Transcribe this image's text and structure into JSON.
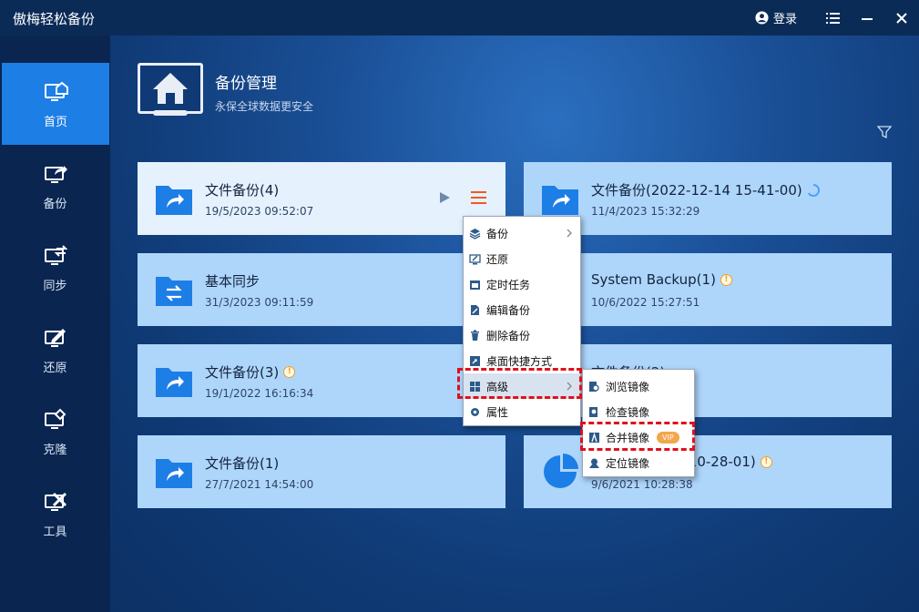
{
  "app": {
    "title": "傲梅轻松备份",
    "login_label": "登录"
  },
  "sidebar": {
    "items": [
      {
        "label": "首页",
        "icon": "home-monitor-icon",
        "active": true
      },
      {
        "label": "备份",
        "icon": "backup-icon"
      },
      {
        "label": "同步",
        "icon": "sync-icon"
      },
      {
        "label": "还原",
        "icon": "restore-icon"
      },
      {
        "label": "克隆",
        "icon": "clone-icon"
      },
      {
        "label": "工具",
        "icon": "tools-icon"
      }
    ]
  },
  "header": {
    "title": "备份管理",
    "subtitle": "永保全球数据更安全"
  },
  "cards": [
    {
      "name": "文件备份(4)",
      "date": "19/5/2023 09:52:07"
    },
    {
      "name": "文件备份(2022-12-14 15-41-00)",
      "date": "11/4/2023 15:32:29"
    },
    {
      "name": "基本同步",
      "date": "31/3/2023 09:11:59"
    },
    {
      "name": "System Backup(1)",
      "date": "10/6/2022 15:27:51"
    },
    {
      "name": "文件备份(3)",
      "date": "19/1/2022 16:16:34"
    },
    {
      "name": "文件备份(2)",
      "date": ""
    },
    {
      "name": "文件备份(1)",
      "date": "27/7/2021 14:54:00"
    },
    {
      "name": "5-09 10-28-01)",
      "date": "9/6/2021 10:28:38"
    }
  ],
  "context_menu": {
    "items": [
      "备份",
      "还原",
      "定时任务",
      "编辑备份",
      "删除备份",
      "桌面快捷方式",
      "高级",
      "属性"
    ]
  },
  "submenu": {
    "items": [
      "浏览镜像",
      "检查镜像",
      "合并镜像",
      "定位镜像"
    ],
    "vip_label": "VIP"
  },
  "colors": {
    "accent": "#1d7ee6",
    "card": "#aed6fb",
    "highlight": "#e0101c",
    "warning": "#f0a11a"
  }
}
